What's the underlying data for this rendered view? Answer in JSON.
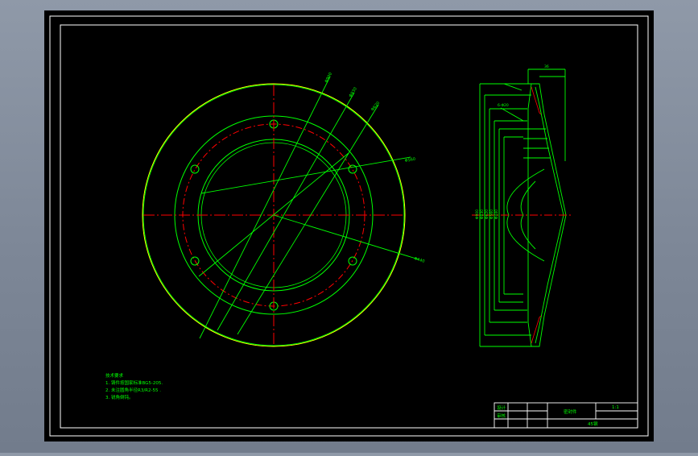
{
  "colors": {
    "background": "#7d8797",
    "sheet": "#000000",
    "border": "#ffffff",
    "geometry": "#00ff00",
    "centerline": "#ff0000",
    "hidden_line": "#ffff00",
    "dimension_text": "#00ff00"
  },
  "drawing": {
    "technical_requirements": {
      "title": "技术要求",
      "items": [
        "1. 铸件按国家标准BG5-205.",
        "2. 未注圆角半径R3/R2-55 .",
        "3. 锐角倒钝。"
      ]
    },
    "title_block": {
      "part_name": "密封件",
      "scale": "1:1",
      "material": "45钢",
      "row_label_1": "设计",
      "row_label_2": "审核"
    },
    "dimension_labels": {
      "plan_view": [
        "Φ900",
        "Φ830",
        "Φ620",
        "Φ560",
        "Φ440"
      ],
      "section_view_top": "36",
      "section_view_stack": [
        "Φ900",
        "Φ830",
        "Φ620",
        "Φ560",
        "Φ440"
      ],
      "section_view_note": "6-Φ20"
    }
  }
}
